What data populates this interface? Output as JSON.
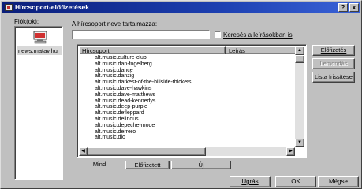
{
  "window": {
    "title": "Hírcsoport-előfizetések"
  },
  "titlebar_buttons": {
    "help": "?",
    "close": "x"
  },
  "accounts": {
    "label": "Fiók(ok):",
    "items": [
      {
        "name": "news.matav.hu"
      }
    ]
  },
  "search": {
    "label": "A hírcsoport neve tartalmazza:",
    "value": "",
    "checkbox_label": "Keresés a leírásokban is",
    "checked": false
  },
  "list": {
    "columns": [
      "Hírcsoport",
      "Leírás"
    ],
    "rows": [
      "alt.music.culture-club",
      "alt.music.dan-fogelberg",
      "alt.music.dance",
      "alt.music.danzig",
      "alt.music.darkest-of-the-hillside-thickets",
      "alt.music.dave-hawkins",
      "alt.music.dave-matthews",
      "alt.music.dead-kennedys",
      "alt.music.deep-purple",
      "alt.music.defleppard",
      "alt.music.delirious",
      "alt.music.depeche-mode",
      "alt.music.derrero",
      "alt.music.dio"
    ]
  },
  "tabs": [
    "Mind",
    "Előfizetett",
    "Új"
  ],
  "side_buttons": {
    "subscribe": "Előfizetés",
    "unsubscribe": "Lemondás",
    "reset_list": "Lista frissítése"
  },
  "bottom_buttons": {
    "goto": "Ugrás",
    "ok": "OK",
    "cancel": "Mégse"
  },
  "colors": {
    "titlebar_start": "#0a1e7a",
    "titlebar_end": "#3a63d8",
    "face": "#c0c0c0"
  }
}
